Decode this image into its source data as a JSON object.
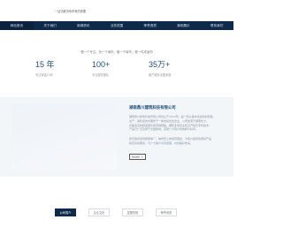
{
  "header": {
    "tagline": "一站式解决你所有的需要",
    "brand_color": "#0d2a4a"
  },
  "nav": {
    "items": [
      {
        "label": "网站首页",
        "active": true
      },
      {
        "label": "关于我们",
        "active": false
      },
      {
        "label": "新闻资讯",
        "active": false
      },
      {
        "label": "业务范围",
        "active": false
      },
      {
        "label": "荣誉资质",
        "active": false
      },
      {
        "label": "案例展示",
        "active": false
      },
      {
        "label": "联系我们",
        "active": false
      }
    ]
  },
  "slogan": "做一个专注、负一个城市、做一个城市、做一件成品的",
  "stats": [
    {
      "value": "15 年",
      "label": "专注家装15年"
    },
    {
      "value": "100+",
      "label": "专业服务团队"
    },
    {
      "value": "35万+",
      "label": "客户服务全国家庭"
    }
  ],
  "about": {
    "title": "湖南鼎川建筑科技有限公司",
    "para1": [
      "湖南鼎川建筑科技有限公司创立于2013年，是一家从事水性涂料的研发、",
      "生产、销售和技术服务于一体的综合性企业，公司坐落于湖南长沙，",
      "具备完善的研发团队和营销网络，拥有多项自主知识产权及专利技术，",
      "产品已广泛应用于全国各地，深受广大客户的信赖与好评。"
    ],
    "para2": [
      "我们始终坚持质量第一、信誉至上的经营理念，为客户提供优质的产品",
      "和完善的服务，与广大客户共同发展，共创美好未来。"
    ],
    "more_label": "MORE +"
  },
  "tabs": [
    {
      "label": "公司简介",
      "active": true
    },
    {
      "label": "企业文化",
      "active": false
    },
    {
      "label": "发展历程",
      "active": false
    },
    {
      "label": "荣誉资质",
      "active": false
    }
  ]
}
